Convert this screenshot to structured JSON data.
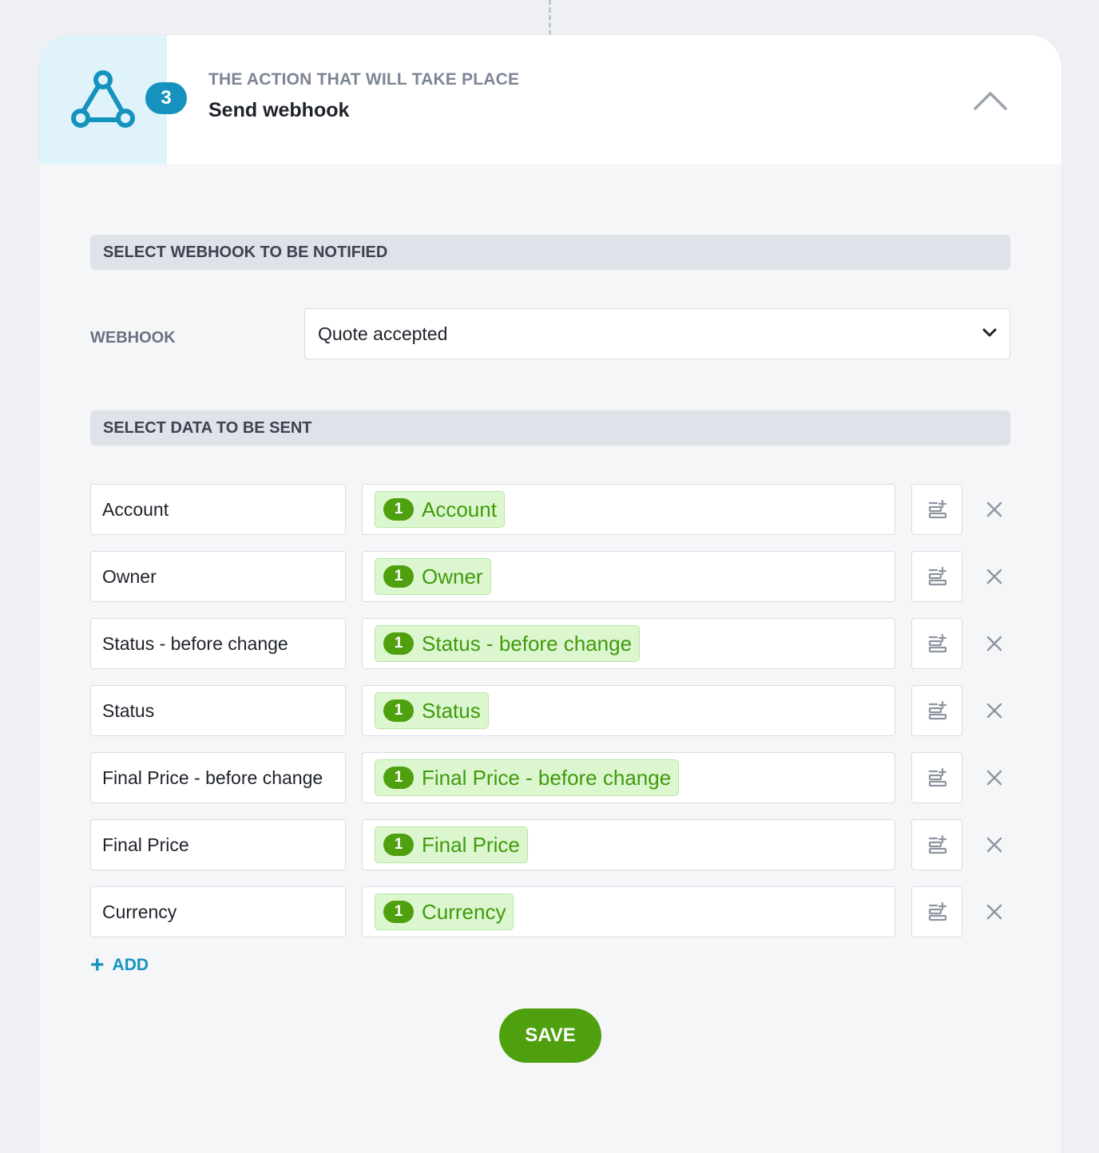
{
  "header": {
    "step_number": "3",
    "caption": "THE ACTION THAT WILL TAKE PLACE",
    "title": "Send webhook",
    "icon": "webhook-icon",
    "collapse_icon": "chevron-up-icon"
  },
  "webhook_section": {
    "heading": "SELECT WEBHOOK TO BE NOTIFIED",
    "label": "WEBHOOK",
    "selected": "Quote accepted"
  },
  "data_section": {
    "heading": "SELECT DATA TO BE SENT",
    "rows": [
      {
        "name": "Account",
        "chip_step": "1",
        "chip_label": "Account"
      },
      {
        "name": "Owner",
        "chip_step": "1",
        "chip_label": "Owner"
      },
      {
        "name": "Status - before change",
        "chip_step": "1",
        "chip_label": "Status - before change"
      },
      {
        "name": "Status",
        "chip_step": "1",
        "chip_label": "Status"
      },
      {
        "name": "Final Price - before change",
        "chip_step": "1",
        "chip_label": "Final Price - before change"
      },
      {
        "name": "Final Price",
        "chip_step": "1",
        "chip_label": "Final Price"
      },
      {
        "name": "Currency",
        "chip_step": "1",
        "chip_label": "Currency"
      }
    ]
  },
  "actions": {
    "add_label": "ADD",
    "save_label": "SAVE"
  },
  "colors": {
    "accent": "#1593be",
    "chip_bg": "#dcf7cf",
    "chip_text": "#3f9a0c",
    "save": "#4fa00f"
  }
}
